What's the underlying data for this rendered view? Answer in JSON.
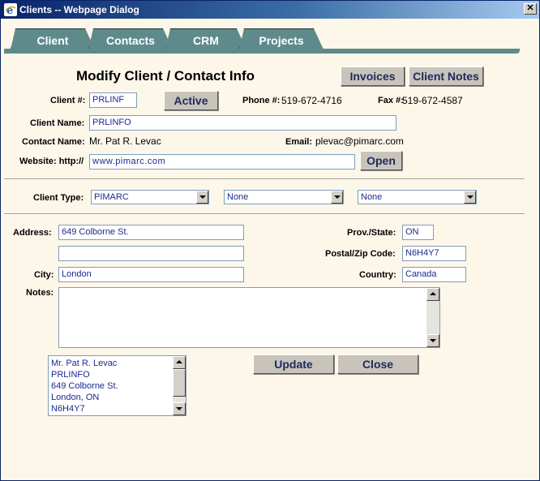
{
  "window": {
    "title": "Clients -- Webpage Dialog",
    "close_glyph": "✕"
  },
  "tabs": [
    {
      "label": "Client",
      "active": true
    },
    {
      "label": "Contacts",
      "active": false
    },
    {
      "label": "CRM",
      "active": false
    },
    {
      "label": "Projects",
      "active": false
    }
  ],
  "header": {
    "title": "Modify Client / Contact Info",
    "invoices_label": "Invoices",
    "client_notes_label": "Client Notes"
  },
  "client": {
    "number_label": "Client #:",
    "number_value": "PRLINF",
    "status_button": "Active",
    "phone_label": "Phone #:",
    "phone_value": "519-672-4716",
    "fax_label": "Fax #:",
    "fax_value": "519-672-4587",
    "name_label": "Client Name:",
    "name_value": "PRLINFO",
    "contact_label": "Contact Name:",
    "contact_value": "Mr. Pat R. Levac",
    "email_label": "Email:",
    "email_value": "plevac@pimarc.com",
    "website_label": "Website: http://",
    "website_value": "www.pimarc.com",
    "open_label": "Open"
  },
  "client_type": {
    "label": "Client Type:",
    "select1": "PIMARC",
    "select2": "None",
    "select3": "None"
  },
  "address": {
    "address_label": "Address:",
    "line1": "649 Colborne St.",
    "line2": "",
    "city_label": "City:",
    "city": "London",
    "prov_label": "Prov./State:",
    "prov": "ON",
    "postal_label": "Postal/Zip Code:",
    "postal": "N6H4Y7",
    "country_label": "Country:",
    "country": "Canada",
    "notes_label": "Notes:",
    "notes": ""
  },
  "summary": [
    "Mr. Pat R. Levac",
    "PRLINFO",
    "649 Colborne St.",
    "London, ON",
    "N6H4Y7"
  ],
  "actions": {
    "update_label": "Update",
    "close_label": "Close"
  },
  "colors": {
    "tab": "#5f8a8b",
    "background": "#fdf7ea",
    "field_text": "#1c2a8c"
  }
}
